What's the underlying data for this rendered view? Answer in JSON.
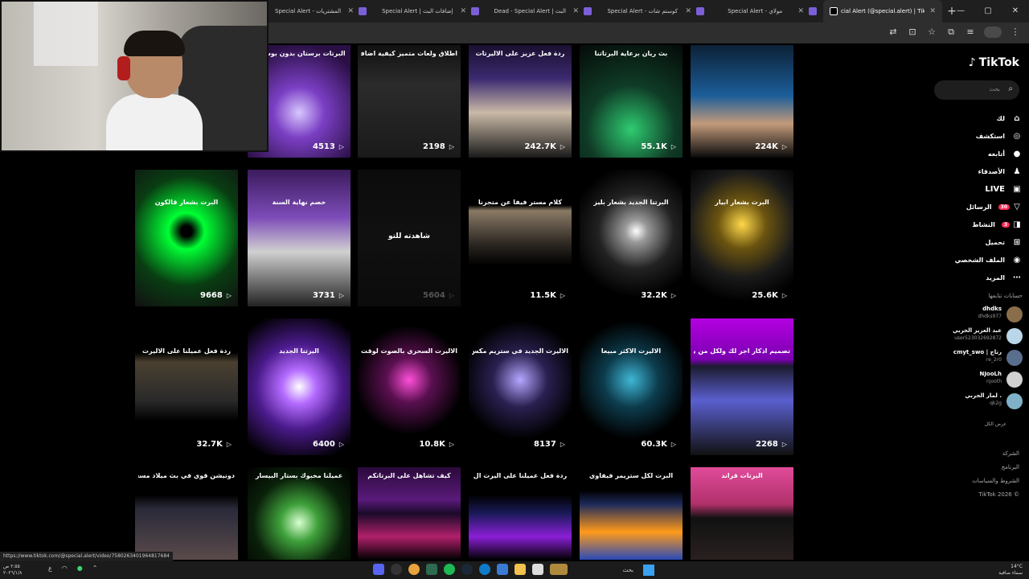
{
  "browser": {
    "tabs": [
      {
        "title": "Special Alert - سلة المشتريات",
        "active": false
      },
      {
        "title": "Special Alert | إضافات البث",
        "active": false
      },
      {
        "title": "Dead - Special Alert | البث",
        "active": false
      },
      {
        "title": "Special Alert - كوستم شات",
        "active": false
      },
      {
        "title": "Special Alert - مولاي",
        "active": false
      },
      {
        "title": "cial Alert (@special.alert) | TikTok",
        "active": true
      }
    ],
    "new_tab_label": "+",
    "window_controls": [
      "—",
      "▢",
      "✕"
    ]
  },
  "videos": [
    {
      "caption": "البرتات برستان بدون بوسيبي",
      "views": "4513",
      "bg": "purple"
    },
    {
      "caption": "اطلاق ولعات متميز كيفية اضافة خاصية رمضان",
      "views": "2198",
      "bg": "gray"
    },
    {
      "caption": "ردة فعل عزيز على الاليرتات",
      "views": "242.7K",
      "bg": "room"
    },
    {
      "caption": "بث ريان برعاية البرتاتنا",
      "views": "55.1K",
      "bg": "green"
    },
    {
      "caption": "",
      "views": "224K",
      "bg": "blue"
    },
    {
      "caption": "البرت بشعار قالكون",
      "views": "9668",
      "bg": "greenfx"
    },
    {
      "caption": "خصم نهاية السنة",
      "views": "3731",
      "bg": "desk"
    },
    {
      "caption": "",
      "views": "5604",
      "bg": "dark",
      "overlay": "شاهدته للتو"
    },
    {
      "caption": "كلام مستر فيفا عن متجرنا",
      "views": "11.5K",
      "bg": "room2"
    },
    {
      "caption": "البرتنا الجديد بشعار بليز",
      "views": "32.2K",
      "bg": "white"
    },
    {
      "caption": "البرت بشعار ابيار",
      "views": "25.6K",
      "bg": "gold"
    },
    {
      "caption": "ردة فعل عميلنا على الاليرت",
      "views": "32.7K",
      "bg": "game"
    },
    {
      "caption": "اليرتنا الجديد",
      "views": "6400",
      "bg": "purplefx"
    },
    {
      "caption": "الاليرت السحري بالصوت لوقت لك",
      "views": "10.8K",
      "bg": "pinklogo"
    },
    {
      "caption": "الاليرت الجديد في ستريم مكس",
      "views": "8137",
      "bg": "darkfx"
    },
    {
      "caption": "الاليرت الاكثر مبيعا",
      "views": "60.3K",
      "bg": "north"
    },
    {
      "caption": "تصميم اذكار اجر لك ولكل من يتابع بثك",
      "views": "2268",
      "bg": "purplescreen"
    },
    {
      "caption": "دونيشن قوي في بث ميلاد مسعد",
      "views": "",
      "bg": "room3"
    },
    {
      "caption": "عميلنا مخبوك بستار البيسار",
      "views": "",
      "bg": "robot"
    },
    {
      "caption": "كيف تشاهل على البرتاتكم",
      "views": "",
      "bg": "pink2"
    },
    {
      "caption": "ردة فعل عميلنا على اليرت ال",
      "views": "",
      "bg": "prediction"
    },
    {
      "caption": "البرت لكل ستريمر فيفاوي",
      "views": "",
      "bg": "soccer"
    },
    {
      "caption": "البرتات قراند",
      "views": "",
      "bg": "pinkroom"
    }
  ],
  "sidebar": {
    "logo": "TikTok",
    "search_placeholder": "بحث",
    "nav": [
      {
        "label": "لك",
        "icon": "home-icon",
        "glyph": "⌂"
      },
      {
        "label": "استكشف",
        "icon": "compass-icon",
        "glyph": "◎"
      },
      {
        "label": "أتابعه",
        "icon": "following-icon",
        "glyph": "●"
      },
      {
        "label": "الأصدقاء",
        "icon": "friends-icon",
        "glyph": "♟"
      },
      {
        "label": "LIVE",
        "icon": "live-icon",
        "glyph": "▣"
      },
      {
        "label": "الرسائل",
        "icon": "messages-icon",
        "glyph": "▽",
        "badge": "30"
      },
      {
        "label": "النشاط",
        "icon": "activity-icon",
        "glyph": "◨",
        "badge": "3"
      },
      {
        "label": "تحميل",
        "icon": "upload-icon",
        "glyph": "⊞"
      },
      {
        "label": "الملف الشخصي",
        "icon": "profile-icon",
        "glyph": "◉"
      },
      {
        "label": "المزيد",
        "icon": "more-icon",
        "glyph": "⋯"
      }
    ],
    "following_heading": "حسابات تتابعها",
    "accounts": [
      {
        "name": "dhdks",
        "handle": "dhdks977",
        "color": "#8a6d4a"
      },
      {
        "name": "عبد العزيز الحربي",
        "handle": "user523032692872",
        "color": "#b9d7e8"
      },
      {
        "name": "cmyt_swo | رتاج",
        "handle": "re_2r0",
        "color": "#5a6f8e"
      },
      {
        "name": "NJooLh",
        "handle": "njooth",
        "color": "#d0d0d0"
      },
      {
        "name": "لمار الحربي .",
        "handle": "qk2g",
        "color": "#7fb2c8"
      }
    ],
    "see_all": "عرض الكل",
    "footer": [
      "الشركة",
      "البرنامج",
      "الشروط والسياسات",
      "© 2026 TikTok"
    ]
  },
  "status_url": "https://www.tiktok.com/@special.alert/video/7580263401964817684",
  "taskbar": {
    "clock": "٢:٥٥ ص\n٢٠٢٦/١/٨",
    "tray_lang": "ع",
    "search_label": "بحث",
    "weather": "14°C\nسماء صافية"
  }
}
